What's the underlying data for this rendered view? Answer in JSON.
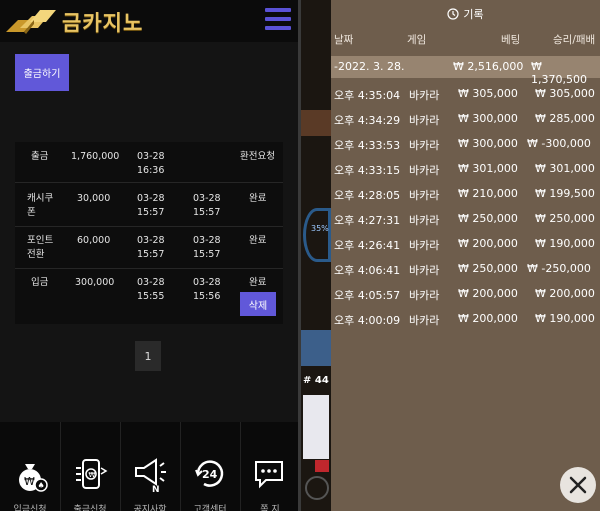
{
  "header": {
    "logo_text": "금카지노"
  },
  "withdraw_button": "출금하기",
  "transactions": [
    {
      "type": "출금",
      "amount": "1,760,000",
      "date1": "03-28",
      "time1": "16:36",
      "date2": "",
      "time2": "",
      "status": "환전요청"
    },
    {
      "type": "캐시쿠\n폰",
      "amount": "30,000",
      "date1": "03-28",
      "time1": "15:57",
      "date2": "03-28",
      "time2": "15:57",
      "status": "완료"
    },
    {
      "type": "포인트\n전환",
      "amount": "60,000",
      "date1": "03-28",
      "time1": "15:57",
      "date2": "03-28",
      "time2": "15:57",
      "status": "완료"
    },
    {
      "type": "입금",
      "amount": "300,000",
      "date1": "03-28",
      "time1": "15:55",
      "date2": "03-28",
      "time2": "15:56",
      "status": "완료"
    }
  ],
  "delete_button": "삭제",
  "pagination": {
    "current": "1"
  },
  "bottom_nav": [
    {
      "label": "입금신청",
      "icon": "money-bag-icon"
    },
    {
      "label": "출금신청",
      "icon": "phone-transfer-icon"
    },
    {
      "label": "공지사항",
      "icon": "megaphone-icon"
    },
    {
      "label": "고객센터",
      "icon": "support-24-icon"
    },
    {
      "label": "쪽 지",
      "icon": "message-icon"
    }
  ],
  "history": {
    "title": "기록",
    "headers": {
      "date": "날짜",
      "game": "게임",
      "bet": "베팅",
      "result": "승리/패배"
    },
    "date_row": {
      "date": "-2022. 3. 28.",
      "bet": "₩ 2,516,000",
      "result": "₩ 1,370,500"
    },
    "rows": [
      {
        "time": "오후 4:35:04",
        "game": "바카라",
        "bet": "₩ 305,000",
        "result": "₩ 305,000"
      },
      {
        "time": "오후 4:34:29",
        "game": "바카라",
        "bet": "₩ 300,000",
        "result": "₩ 285,000"
      },
      {
        "time": "오후 4:33:53",
        "game": "바카라",
        "bet": "₩ 300,000",
        "result": "₩ -300,000"
      },
      {
        "time": "오후 4:33:15",
        "game": "바카라",
        "bet": "₩ 301,000",
        "result": "₩ 301,000"
      },
      {
        "time": "오후 4:28:05",
        "game": "바카라",
        "bet": "₩ 210,000",
        "result": "₩ 199,500"
      },
      {
        "time": "오후 4:27:31",
        "game": "바카라",
        "bet": "₩ 250,000",
        "result": "₩ 250,000"
      },
      {
        "time": "오후 4:26:41",
        "game": "바카라",
        "bet": "₩ 200,000",
        "result": "₩ 190,000"
      },
      {
        "time": "오후 4:06:41",
        "game": "바카라",
        "bet": "₩ 250,000",
        "result": "₩ -250,000"
      },
      {
        "time": "오후 4:05:57",
        "game": "바카라",
        "bet": "₩ 200,000",
        "result": "₩ 200,000"
      },
      {
        "time": "오후 4:00:09",
        "game": "바카라",
        "bet": "₩ 200,000",
        "result": "₩ 190,000"
      }
    ]
  },
  "game_background": {
    "badge_percent": "35%",
    "table_number": "# 44"
  },
  "colors": {
    "accent": "#6158d9",
    "gold": "#e8c463",
    "panel": "#6e5d4c",
    "selected_row": "#978470"
  }
}
